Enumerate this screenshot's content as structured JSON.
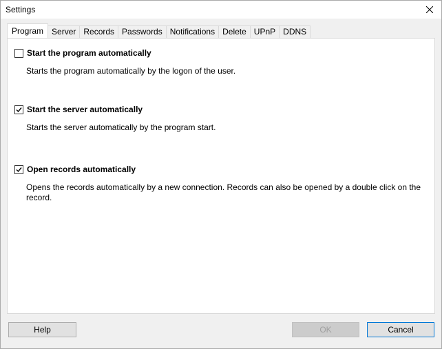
{
  "window": {
    "title": "Settings"
  },
  "tabs": [
    "Program",
    "Server",
    "Records",
    "Passwords",
    "Notifications",
    "Delete",
    "UPnP",
    "DDNS"
  ],
  "active_tab": "Program",
  "options": [
    {
      "label": "Start the program automatically",
      "checked": false,
      "description": "Starts the program automatically by the logon of the user."
    },
    {
      "label": "Start the server automatically",
      "checked": true,
      "description": "Starts the server automatically by the program start."
    },
    {
      "label": "Open records automatically",
      "checked": true,
      "description": "Opens the records automatically by a new connection. Records can also be opened by a double click on the record."
    }
  ],
  "buttons": {
    "help": "Help",
    "ok": "OK",
    "cancel": "Cancel"
  },
  "icons": {
    "close": "close-icon",
    "check": "checkmark-icon"
  }
}
